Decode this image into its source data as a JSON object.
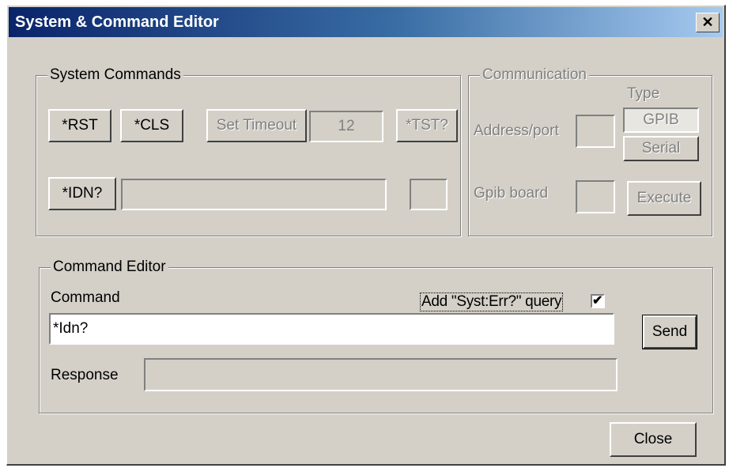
{
  "window": {
    "title": "System & Command Editor",
    "close_glyph": "✕"
  },
  "system_commands": {
    "title": "System  Commands",
    "rst_label": "*RST",
    "cls_label": "*CLS",
    "set_timeout_label": "Set Timeout",
    "timeout_value": "12",
    "tst_label": "*TST?",
    "idn_label": "*IDN?",
    "idn_response": "",
    "tst_result": ""
  },
  "communication": {
    "title": "Communication",
    "type_label": "Type",
    "gpib_label": "GPIB",
    "serial_label": "Serial",
    "address_label": "Address/port",
    "address_value": "",
    "gpib_board_label": "Gpib board",
    "gpib_board_value": "",
    "execute_label": "Execute"
  },
  "command_editor": {
    "title": "Command Editor",
    "command_label": "Command",
    "syst_err_label": "Add \"Syst:Err?\" query",
    "syst_err_checked": true,
    "check_glyph": "✔",
    "command_value": "*Idn?",
    "send_label": "Send",
    "response_label": "Response",
    "response_value": ""
  },
  "footer": {
    "close_label": "Close"
  }
}
